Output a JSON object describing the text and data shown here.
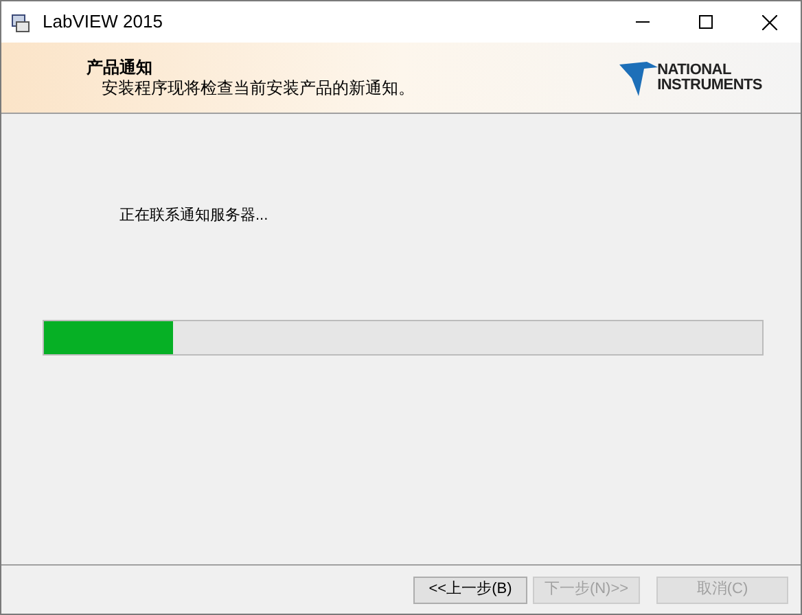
{
  "window": {
    "title": "LabVIEW 2015"
  },
  "header": {
    "title": "产品通知",
    "subtitle": "安装程序现将检查当前安装产品的新通知。",
    "logo": [
      "NATIONAL",
      "INSTRUMENTS"
    ]
  },
  "status": {
    "message": "正在联系通知服务器..."
  },
  "progress": {
    "level": 0.18
  },
  "buttons": [
    {
      "label": "<<上一步(B)",
      "disabled": false
    },
    {
      "label": "下一步(N)>>",
      "disabled": true
    },
    {
      "label": "取消(C)",
      "disabled": true
    }
  ]
}
